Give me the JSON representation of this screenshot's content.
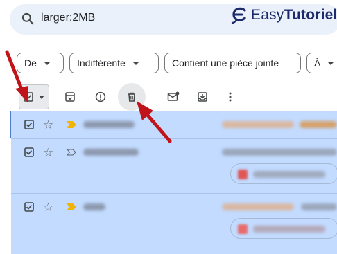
{
  "search": {
    "query": "larger:2MB"
  },
  "logo": {
    "prefix": "Easy",
    "suffix": "Tutoriel"
  },
  "filters": [
    {
      "label": "De"
    },
    {
      "label": "Indifférente"
    },
    {
      "label": "Contient une pièce jointe"
    },
    {
      "label": "À"
    }
  ],
  "toolbar": {
    "select_all_state": "checked",
    "actions": [
      "archive",
      "report-spam",
      "delete",
      "mark-unread",
      "move-to",
      "more"
    ]
  },
  "colors": {
    "accent": "#c2dbff",
    "arrow": "#c0141a",
    "important": "#f2b400",
    "logo": "#1c2a6b"
  },
  "rows": [
    {
      "selected": true,
      "starred": false,
      "important": true
    },
    {
      "selected": true,
      "starred": false,
      "important": false
    },
    {
      "selected": true,
      "starred": false,
      "important": true
    }
  ]
}
